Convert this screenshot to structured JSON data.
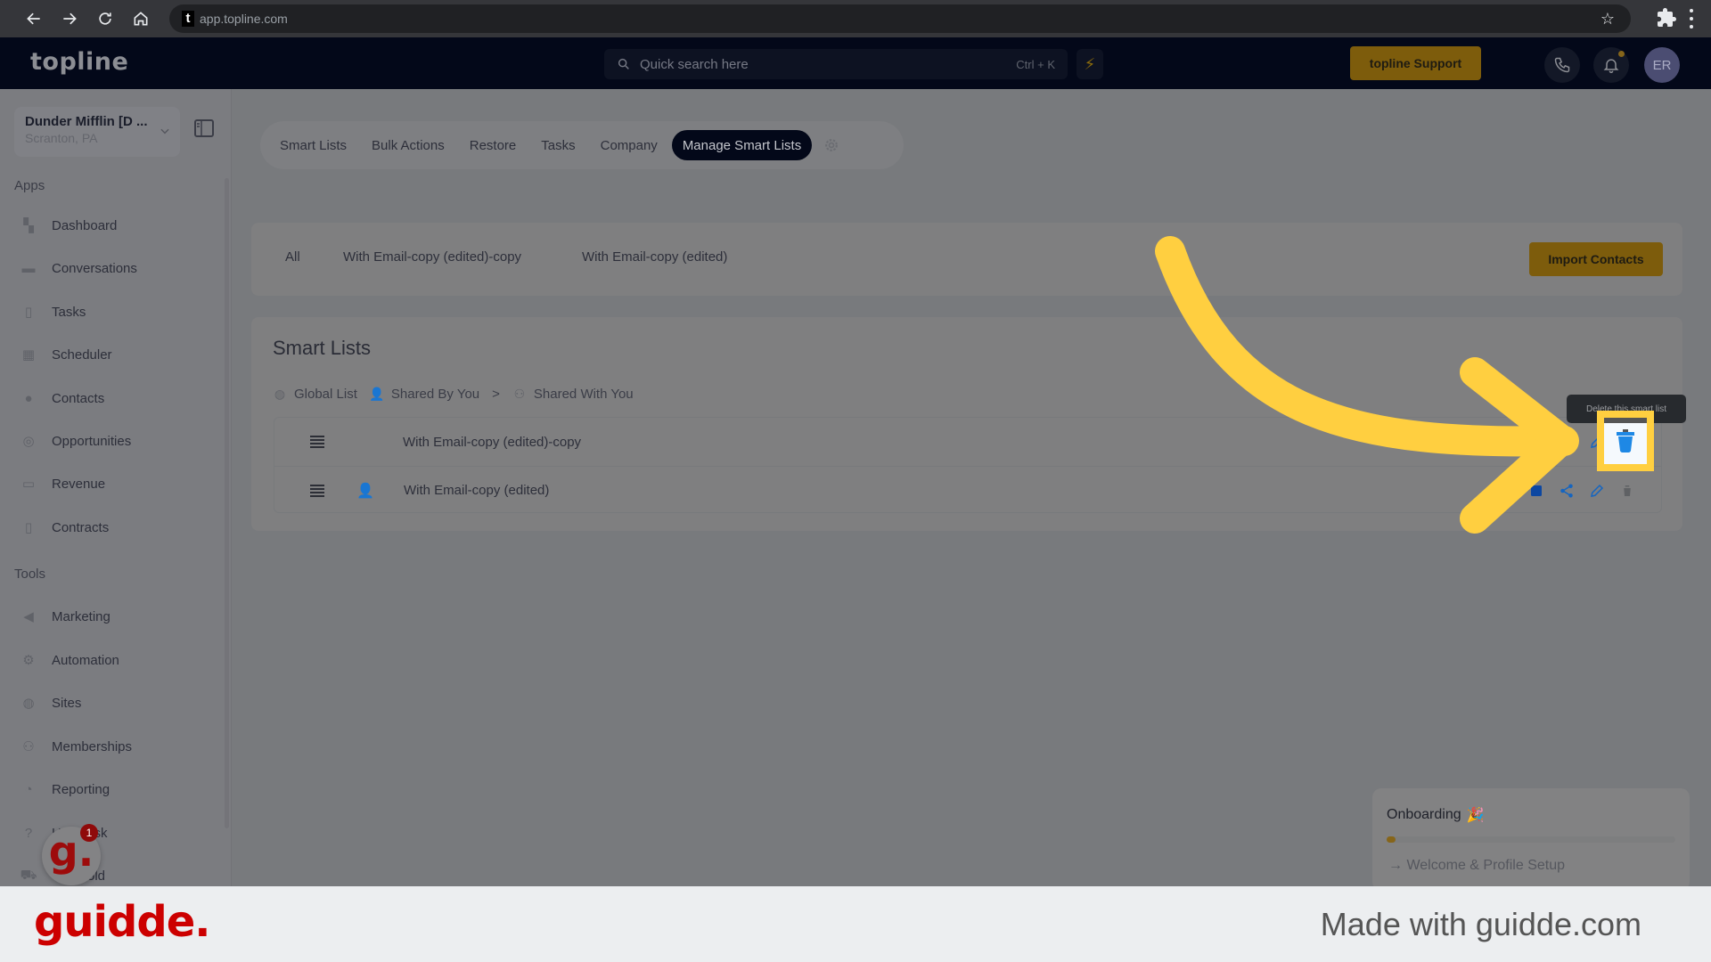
{
  "browser": {
    "url": "app.topline.com",
    "favicon_letter": "t"
  },
  "header": {
    "logo": "topline",
    "search_placeholder": "Quick search here",
    "search_shortcut": "Ctrl + K",
    "support_label": "topline Support",
    "avatar_initials": "ER",
    "flash_icon": "⚡"
  },
  "sidebar": {
    "account_name": "Dunder Mifflin [D ...",
    "account_location": "Scranton,  PA",
    "sections": {
      "apps": "Apps",
      "tools": "Tools"
    },
    "apps_items": [
      {
        "label": "Dashboard",
        "icon": "dashboard-icon"
      },
      {
        "label": "Conversations",
        "icon": "chat-icon"
      },
      {
        "label": "Tasks",
        "icon": "task-icon"
      },
      {
        "label": "Scheduler",
        "icon": "calendar-icon"
      },
      {
        "label": "Contacts",
        "icon": "user-icon"
      },
      {
        "label": "Opportunities",
        "icon": "target-icon"
      },
      {
        "label": "Revenue",
        "icon": "card-icon"
      },
      {
        "label": "Contracts",
        "icon": "document-icon"
      }
    ],
    "tools_items": [
      {
        "label": "Marketing",
        "icon": "megaphone-icon"
      },
      {
        "label": "Automation",
        "icon": "gears-icon"
      },
      {
        "label": "Sites",
        "icon": "globe-icon"
      },
      {
        "label": "Memberships",
        "icon": "members-icon"
      },
      {
        "label": "Reporting",
        "icon": "pie-chart-icon"
      },
      {
        "label": "Helpdesk",
        "icon": "help-icon"
      },
      {
        "label": "old",
        "icon": "store-icon"
      }
    ],
    "guidde_badge_count": "1",
    "guidde_glyph": "g."
  },
  "tabs": {
    "items": [
      "Smart Lists",
      "Bulk Actions",
      "Restore",
      "Tasks",
      "Company",
      "Manage Smart Lists"
    ],
    "active": "Manage Smart Lists"
  },
  "filters": {
    "items": [
      "All",
      "With Email-copy (edited)-copy",
      "With Email-copy (edited)"
    ],
    "import_label": "Import Contacts"
  },
  "smart_lists": {
    "title": "Smart Lists",
    "legend": {
      "global": "Global List",
      "shared_by_you": "Shared By You",
      "separator": ">",
      "shared_with_you": "Shared With You"
    },
    "rows": [
      {
        "name": "With Email-copy (edited)-copy",
        "shared": false
      },
      {
        "name": "With Email-copy (edited)",
        "shared": true
      }
    ],
    "tooltip": "Delete this smart list"
  },
  "onboarding": {
    "title": "Onboarding",
    "emoji": "🎉",
    "progress_percent": 3,
    "step": "Welcome & Profile Setup"
  },
  "footer": {
    "logo": "guidde.",
    "tagline": "Made with guidde.com"
  },
  "colors": {
    "accent_yellow": "#ffcf40",
    "brand_gold": "#7d5c0c",
    "action_blue": "#1e88e5",
    "guidde_red": "#cc0000",
    "header_dark": "#030819"
  }
}
